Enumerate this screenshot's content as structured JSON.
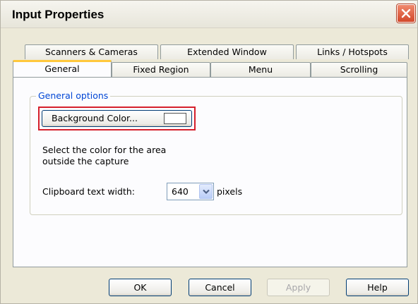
{
  "window": {
    "title": "Input Properties",
    "close_icon": "close-x-icon"
  },
  "tabs": {
    "back_row": [
      "Scanners & Cameras",
      "Extended Window",
      "Links / Hotspots"
    ],
    "front_row": [
      "General",
      "Fixed Region",
      "Menu",
      "Scrolling"
    ],
    "active": "General"
  },
  "general": {
    "group_label": "General options",
    "background_button_label": "Background Color...",
    "background_color": "#ffffff",
    "description_line1": "Select the color for the area",
    "description_line2": "outside the capture",
    "clipboard_label": "Clipboard text width:",
    "clipboard_width_value": "640",
    "clipboard_unit": "pixels"
  },
  "footer": {
    "ok_label": "OK",
    "cancel_label": "Cancel",
    "apply_label": "Apply",
    "help_label": "Help"
  },
  "colors": {
    "highlight_border": "#d51f2b",
    "group_label": "#0046d5",
    "active_tab_accent": "#ffc83c"
  }
}
